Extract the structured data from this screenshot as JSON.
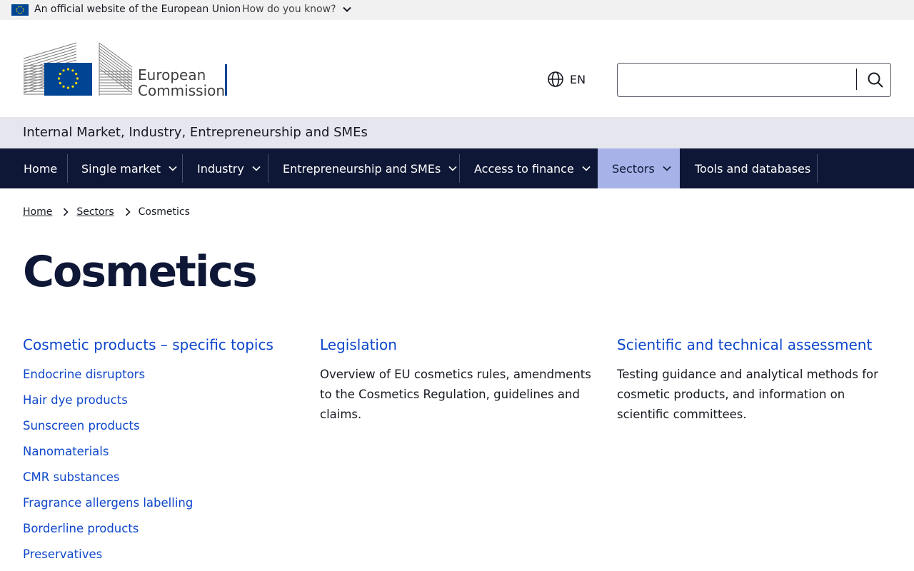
{
  "banner": {
    "official_text": "An official website of the European Union",
    "how_know": "How do you know?"
  },
  "header": {
    "logo_line1": "European",
    "logo_line2": "Commission",
    "language": "EN",
    "search_placeholder": ""
  },
  "site_name": "Internal Market, Industry, Entrepreneurship and SMEs",
  "nav": {
    "items": [
      {
        "label": "Home"
      },
      {
        "label": "Single market"
      },
      {
        "label": "Industry"
      },
      {
        "label": "Entrepreneurship and SMEs"
      },
      {
        "label": "Access to finance"
      },
      {
        "label": "Sectors"
      },
      {
        "label": "Tools and databases"
      }
    ]
  },
  "breadcrumb": {
    "items": [
      "Home",
      "Sectors"
    ],
    "current": "Cosmetics"
  },
  "page_title": "Cosmetics",
  "columns": [
    {
      "heading": "Cosmetic products – specific topics",
      "links": [
        "Endocrine disruptors",
        "Hair dye products",
        "Sunscreen products",
        "Nanomaterials",
        "CMR substances",
        "Fragrance allergens labelling",
        "Borderline products",
        "Preservatives"
      ]
    },
    {
      "heading": "Legislation",
      "description": "Overview of EU cosmetics rules, amendments to the Cosmetics Regulation, guidelines and claims."
    },
    {
      "heading": "Scientific and technical assessment",
      "description": "Testing guidance and analytical methods for cosmetic products, and information on scientific committees."
    }
  ],
  "colors": {
    "nav_bg": "#0e1736",
    "nav_active": "#a7b3e8",
    "link": "#0e47cb",
    "eu_blue": "#004494",
    "eu_yellow": "#ffdd00"
  }
}
